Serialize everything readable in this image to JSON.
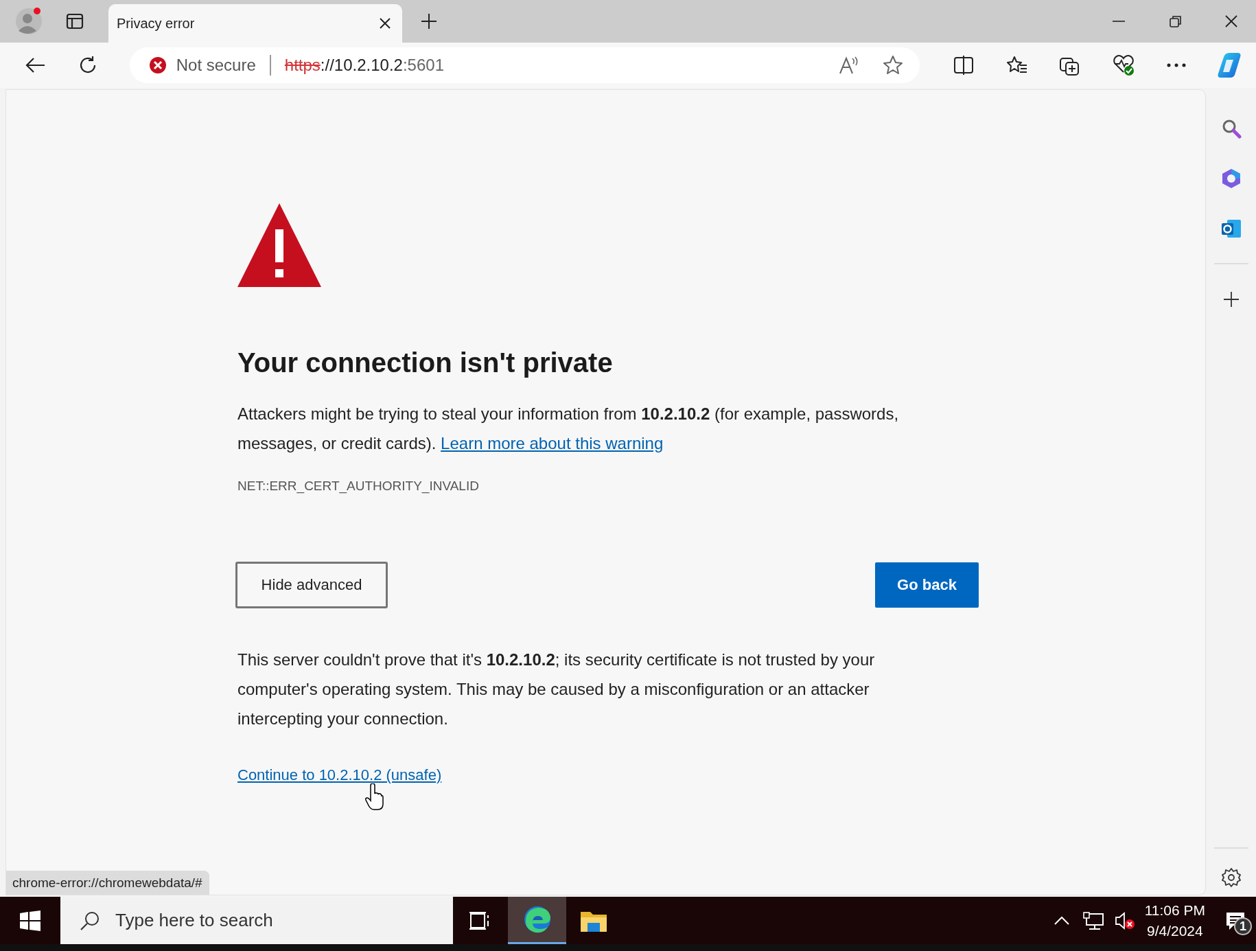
{
  "tab": {
    "title": "Privacy error"
  },
  "address_bar": {
    "security_label": "Not secure",
    "url_scheme": "https",
    "url_host": "://10.2.10.2",
    "url_port": ":5601"
  },
  "page": {
    "heading": "Your connection isn't private",
    "message": "Attackers might be trying to steal your information from **10.2.10.2** (for example, passwords, messages, or credit cards).",
    "learn_more_link": "Learn more about this warning",
    "error_code": "NET::ERR_CERT_AUTHORITY_INVALID",
    "buttons": [
      {
        "label": "Hide advanced",
        "kind": "secondary"
      },
      {
        "label": "Go back",
        "kind": "primary"
      }
    ],
    "details": "This server couldn't prove that it's **10.2.10.2**; its security certificate is not trusted by your computer's operating system. This may be caused by a misconfiguration or an attacker intercepting your connection.",
    "proceed_link": "Continue to 10.2.10.2 (unsafe)"
  },
  "status_bubble": "chrome-error://chromewebdata/#",
  "taskbar": {
    "search_placeholder": "Type here to search",
    "time": "11:06 PM",
    "date": "9/4/2024",
    "notification_count": "1"
  }
}
